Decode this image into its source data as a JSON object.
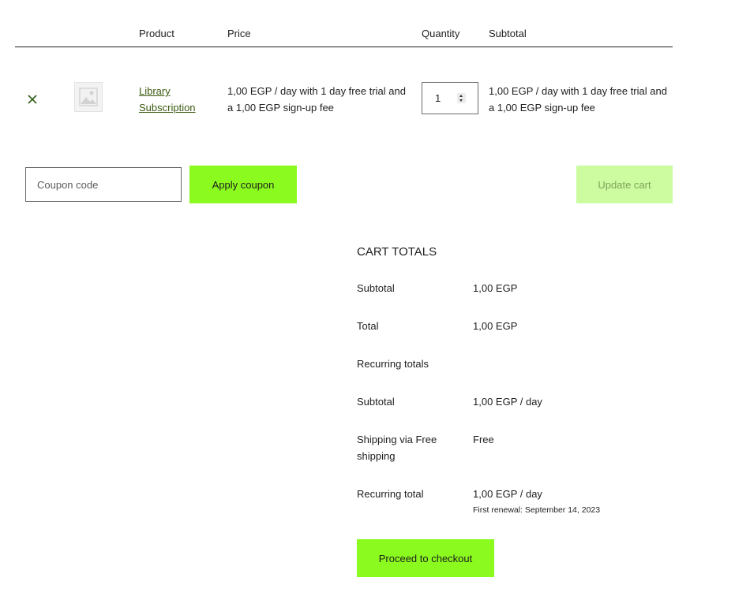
{
  "table": {
    "headers": {
      "product": "Product",
      "price": "Price",
      "quantity": "Quantity",
      "subtotal": "Subtotal"
    },
    "row": {
      "remove_icon": "close-icon",
      "thumbnail_icon": "image-placeholder-icon",
      "product_line1": "Library",
      "product_line2": "Subscription",
      "price_line1": "1,00 EGP / day with 1 day free trial and",
      "price_line2": "a 1,00 EGP sign-up fee",
      "quantity": "1",
      "subtotal_line1": "1,00 EGP / day with 1 day free trial and",
      "subtotal_line2": "a 1,00 EGP sign-up fee"
    }
  },
  "actions": {
    "coupon_placeholder": "Coupon code",
    "apply_label": "Apply coupon",
    "update_label": "Update cart"
  },
  "cart_totals": {
    "title": "CART TOTALS",
    "subtotal_label": "Subtotal",
    "subtotal_value": "1,00 EGP",
    "total_label": "Total",
    "total_value": "1,00 EGP",
    "recurring_heading": "Recurring totals",
    "recurring_subtotal_label": "Subtotal",
    "recurring_subtotal_value": "1,00 EGP / day",
    "shipping_label_line1": "Shipping via Free",
    "shipping_label_line2": "shipping",
    "shipping_value": "Free",
    "recurring_total_label": "Recurring total",
    "recurring_total_value": "1,00 EGP / day",
    "first_renewal": "First renewal: September 14, 2023",
    "checkout_label": "Proceed to checkout"
  },
  "colors": {
    "accent": "#8bfa1f",
    "accent_disabled": "#ccfba0",
    "link": "#3c5a10",
    "remove_icon": "#2e5d12"
  }
}
